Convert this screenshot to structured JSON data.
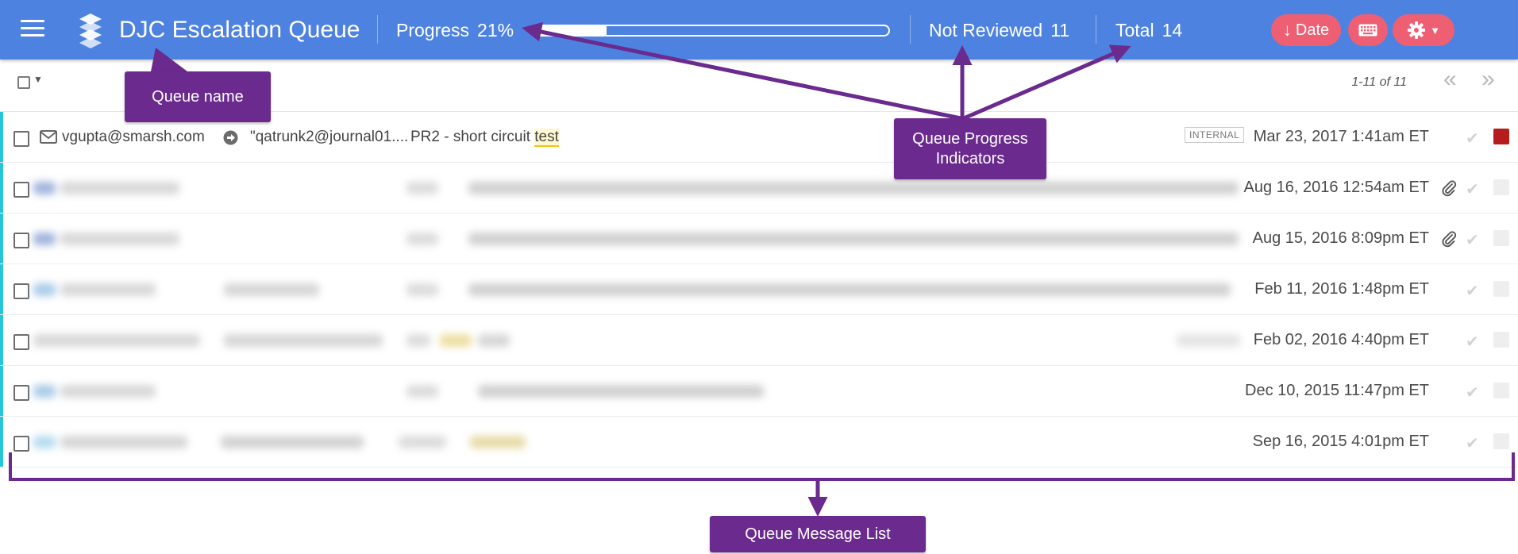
{
  "header": {
    "title": "DJC Escalation Queue",
    "progress_label": "Progress",
    "progress_value": "21%",
    "progress_fraction": 0.21,
    "not_reviewed_label": "Not Reviewed",
    "not_reviewed_value": "11",
    "total_label": "Total",
    "total_value": "14",
    "sort_button_label": "Date",
    "sort_icon": "arrow-down-icon",
    "keyboard_icon": "keyboard-icon",
    "settings_icon": "gear-icon",
    "accent_color": "#4e82e0",
    "button_color": "#ef5f73"
  },
  "toolbar": {
    "pagination": "1-11 of 11"
  },
  "messages": [
    {
      "sender": "vgupta@smarsh.com",
      "recipient": "\"qatrunk2@journal01....",
      "subject_pre": "PR2 - short circuit ",
      "subject_highlight": "test",
      "tag": "INTERNAL",
      "date": "Mar 23, 2017 1:41am ET",
      "status": "red"
    },
    {
      "date": "Aug 16, 2016 12:54am ET",
      "attachment": true,
      "status": "empty"
    },
    {
      "date": "Aug 15, 2016 8:09pm ET",
      "attachment": true,
      "status": "empty"
    },
    {
      "date": "Feb 11, 2016 1:48pm ET",
      "attachment": false,
      "status": "empty"
    },
    {
      "date": "Feb 02, 2016 4:40pm ET",
      "attachment": false,
      "status": "empty"
    },
    {
      "date": "Dec 10, 2015 11:47pm ET",
      "attachment": false,
      "status": "empty"
    },
    {
      "date": "Sep 16, 2015 4:01pm ET",
      "attachment": false,
      "status": "empty"
    }
  ],
  "annotations": {
    "queue_name": "Queue name",
    "progress_line1": "Queue Progress",
    "progress_line2": "Indicators",
    "message_list": "Queue Message List",
    "color": "#6a2a8e"
  }
}
